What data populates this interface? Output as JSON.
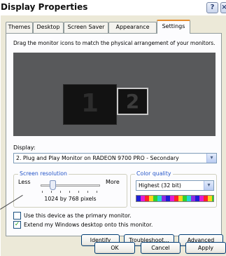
{
  "window": {
    "title": "Display Properties",
    "help_glyph": "?",
    "close_glyph": "×"
  },
  "tabs": [
    {
      "label": "Themes",
      "active": false
    },
    {
      "label": "Desktop",
      "active": false
    },
    {
      "label": "Screen Saver",
      "active": false
    },
    {
      "label": "Appearance",
      "active": false
    },
    {
      "label": "Settings",
      "active": true
    }
  ],
  "settings": {
    "instruction": "Drag the monitor icons to match the physical arrangement of your monitors.",
    "monitors": [
      {
        "number": "1"
      },
      {
        "number": "2"
      }
    ],
    "display_label": "Display:",
    "display_value": "2. Plug and Play Monitor on RADEON 9700 PRO - Secondary",
    "screen_resolution": {
      "legend": "Screen resolution",
      "less_label": "Less",
      "more_label": "More",
      "value": "1024 by 768 pixels"
    },
    "color_quality": {
      "legend": "Color quality",
      "value": "Highest (32 bit)"
    },
    "checkboxes": [
      {
        "label": "Use this device as the primary monitor.",
        "checked": false
      },
      {
        "label": "Extend my Windows desktop onto this monitor.",
        "checked": true
      }
    ],
    "buttons": {
      "identify": "Identify",
      "troubleshoot": "Troubleshoot...",
      "advanced": "Advanced"
    }
  },
  "dialog_buttons": {
    "ok": "OK",
    "cancel": "Cancel",
    "apply": "Apply"
  },
  "colors": {
    "active_tab_accent": "#e68b2c",
    "monitor_area_bg": "#58595b",
    "dialog_bg": "#ece9d8",
    "checkmark": "#21a121"
  }
}
